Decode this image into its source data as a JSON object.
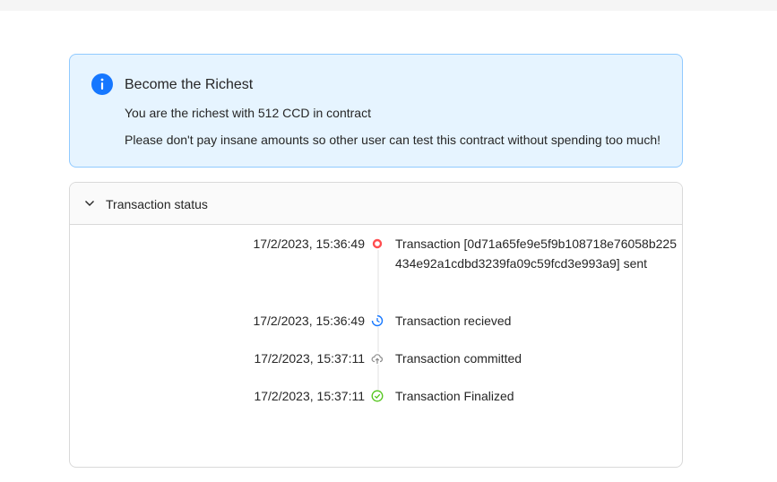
{
  "alert": {
    "title": "Become the Richest",
    "line1": "You are the richest with 512 CCD in contract",
    "line2": "Please don't pay insane amounts so other user can test this contract without spending too much!",
    "icon": "info-icon"
  },
  "status_panel": {
    "title": "Transaction status",
    "expanded": true,
    "items": [
      {
        "time": "17/2/2023, 15:36:49",
        "text": "Transaction [0d71a65fe9e5f9b108718e76058b225434e92a1cdbd3239fa09c59fcd3e993a9] sent",
        "icon": "sent-dot-icon",
        "color": "#ff4d4f"
      },
      {
        "time": "17/2/2023, 15:36:49",
        "text": "Transaction recieved",
        "icon": "received-clock-icon",
        "color": "#1677ff"
      },
      {
        "time": "17/2/2023, 15:37:11",
        "text": "Transaction committed",
        "icon": "cloud-upload-icon",
        "color": "#8c8c8c"
      },
      {
        "time": "17/2/2023, 15:37:11",
        "text": "Transaction Finalized",
        "icon": "check-circle-icon",
        "color": "#52c41a"
      }
    ]
  }
}
